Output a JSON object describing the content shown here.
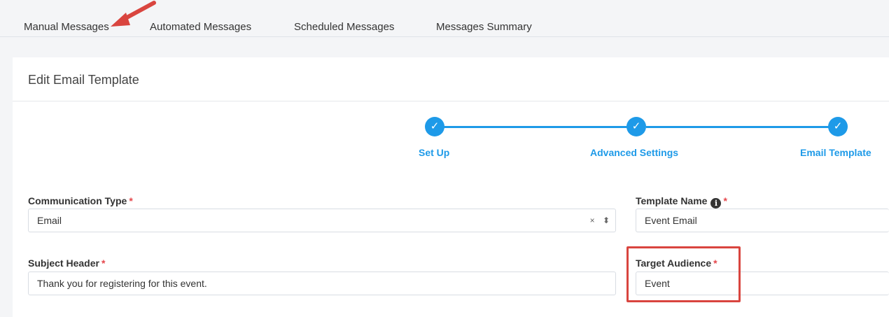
{
  "tabs": [
    {
      "label": "Manual Messages"
    },
    {
      "label": "Automated Messages"
    },
    {
      "label": "Scheduled Messages"
    },
    {
      "label": "Messages Summary"
    }
  ],
  "card": {
    "title": "Edit Email Template"
  },
  "steps": [
    {
      "label": "Set Up",
      "icon": "check-icon",
      "glyph": "✓"
    },
    {
      "label": "Advanced Settings",
      "icon": "check-icon",
      "glyph": "✓"
    },
    {
      "label": "Email Template",
      "icon": "check-icon",
      "glyph": "✓"
    }
  ],
  "form": {
    "communication_type": {
      "label": "Communication Type",
      "value": "Email",
      "clear": "×",
      "toggle": "⬍"
    },
    "template_name": {
      "label": "Template Name",
      "value": "Event Email",
      "info_glyph": "i"
    },
    "subject_header": {
      "label": "Subject Header",
      "value": "Thank you for registering for this event."
    },
    "target_audience": {
      "label": "Target Audience",
      "value": "Event"
    },
    "required_marker": "*"
  },
  "colors": {
    "accent": "#1e9ae8",
    "required": "#e5484d",
    "annotation": "#d9453f"
  }
}
